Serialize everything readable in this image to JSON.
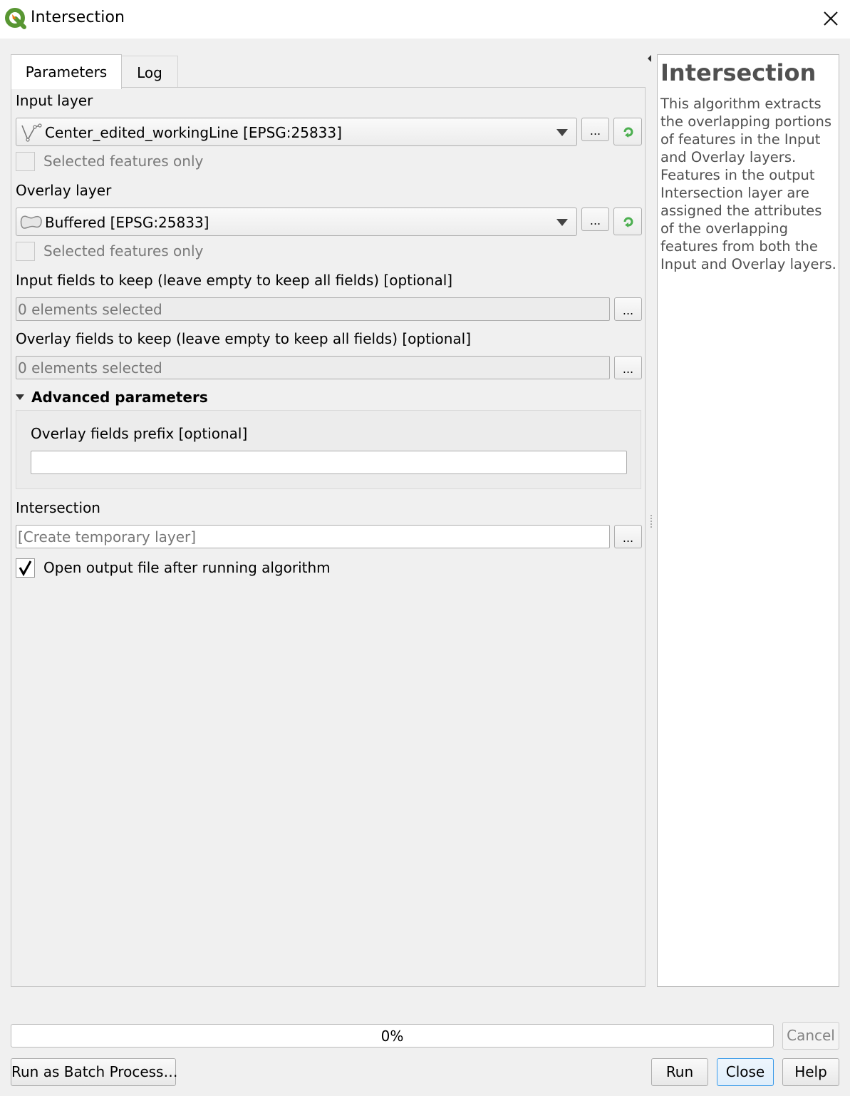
{
  "window": {
    "title": "Intersection",
    "app_icon": "qgis-logo-icon",
    "close_icon": "close-icon"
  },
  "tabs": [
    {
      "label": "Parameters",
      "active": true
    },
    {
      "label": "Log",
      "active": false
    }
  ],
  "params": {
    "input_layer": {
      "label": "Input layer",
      "value": "Center_edited_workingLine [EPSG:25833]",
      "icon": "line-layer-icon",
      "browse_label": "...",
      "selected_only_label": "Selected features only",
      "selected_only_checked": false
    },
    "overlay_layer": {
      "label": "Overlay layer",
      "value": "Buffered [EPSG:25833]",
      "icon": "polygon-layer-icon",
      "browse_label": "...",
      "selected_only_label": "Selected features only",
      "selected_only_checked": false
    },
    "input_fields": {
      "label": "Input fields to keep (leave empty to keep all fields) [optional]",
      "value": "0 elements selected",
      "browse_label": "..."
    },
    "overlay_fields": {
      "label": "Overlay fields to keep (leave empty to keep all fields) [optional]",
      "value": "0 elements selected",
      "browse_label": "..."
    },
    "advanced": {
      "label": "Advanced parameters",
      "expanded": true,
      "prefix_label": "Overlay fields prefix [optional]",
      "prefix_value": ""
    },
    "output": {
      "label": "Intersection",
      "placeholder": "[Create temporary layer]",
      "browse_label": "..."
    },
    "open_output": {
      "label": "Open output file after running algorithm",
      "checked": true
    }
  },
  "help": {
    "title": "Intersection",
    "text": "This algorithm extracts the overlapping portions of features in the Input and Overlay layers. Features in the output Intersection layer are assigned the attributes of the overlapping features from both the Input and Overlay layers."
  },
  "progress": {
    "value_percent": 0,
    "label": "0%"
  },
  "buttons": {
    "cancel": "Cancel",
    "batch": "Run as Batch Process…",
    "run": "Run",
    "close": "Close",
    "help": "Help"
  },
  "colors": {
    "qgis_green": "#589632",
    "qgis_yellow": "#ee7913",
    "iterate_green": "#4caf50",
    "focus_blue": "#3a9ae8"
  }
}
